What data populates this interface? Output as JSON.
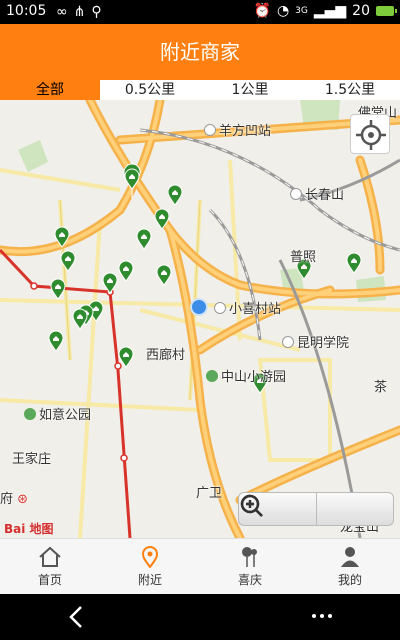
{
  "status_bar": {
    "time": "10:05",
    "network": "3G",
    "battery_level": "20"
  },
  "header": {
    "title": "附近商家"
  },
  "distance_tabs": [
    {
      "label": "全部",
      "active": true
    },
    {
      "label": "0.5公里",
      "active": false
    },
    {
      "label": "1公里",
      "active": false
    },
    {
      "label": "1.5公里",
      "active": false
    }
  ],
  "map": {
    "labels": {
      "yangfangao": "羊方凹站",
      "changchunshan": "长春山",
      "puzhao": "普照",
      "xiaoxicun": "小喜村站",
      "kunming_xueyuan": "昆明学院",
      "xilangcun": "西廊村",
      "zhongshan_park": "中山小游园",
      "ruyi_park": "如意公园",
      "wangjiazhuang": "王家庄",
      "guangwei": "广卫",
      "fu": "府",
      "fotangshan": "佛堂山",
      "cha": "茶",
      "longbaoshan": "龙宝山"
    },
    "logo": "Bai 地图",
    "accent_color": "#ff7f10",
    "marker_color": "#2e8b2e"
  },
  "bottom_nav": [
    {
      "label": "首页",
      "icon": "home-icon"
    },
    {
      "label": "附近",
      "icon": "location-pin-icon",
      "active": true
    },
    {
      "label": "喜庆",
      "icon": "celebration-icon"
    },
    {
      "label": "我的",
      "icon": "user-icon"
    }
  ]
}
